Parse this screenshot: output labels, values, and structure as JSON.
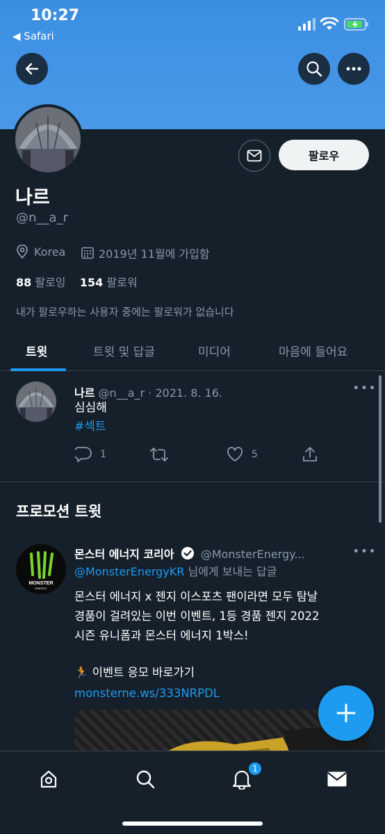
{
  "status_bar": {
    "time": "10:27",
    "back_app": "◀ Safari"
  },
  "profile": {
    "name": "나르",
    "handle": "@n__a_r",
    "follow_label": "팔로우",
    "location": "Korea",
    "joined": "2019년 11월에 가입함",
    "following_count": "88",
    "following_label": "팔로잉",
    "followers_count": "154",
    "followers_label": "팔로워",
    "followers_note": "내가 팔로우하는 사용자 중에는 팔로워가 없습니다"
  },
  "tabs": [
    {
      "label": "트윗",
      "active": true
    },
    {
      "label": "트윗 및 답글",
      "active": false
    },
    {
      "label": "미디어",
      "active": false
    },
    {
      "label": "마음에 들어요",
      "active": false
    }
  ],
  "tweet1": {
    "name": "나르",
    "handle_date": "@n__a_r · 2021. 8. 16.",
    "text": "심심해",
    "hashtag": "#섹트",
    "replies": "1",
    "likes": "5"
  },
  "promo": {
    "section_title": "프로모션 트윗",
    "name": "몬스터 에너지 코리아",
    "handle": "@MonsterEnergy...",
    "reply_to_handle": "@MonsterEnergyKR",
    "reply_to_suffix": " 님에게 보내는 답글",
    "text_line1": "몬스터 에너지 x 젠지 이스포츠 팬이라면 모두 탐날",
    "text_line2": "경품이 걸려있는 이번 이벤트, 1등 경품 젠지 2022",
    "text_line3": "시즌 유니폼과 몬스터 에너지 1박스!",
    "event_line": "🏃 이벤트 응모 바로가기",
    "link": "monsterne.ws/333NRPDL"
  },
  "bottom_nav": {
    "notification_badge": "1"
  },
  "icons": [
    "back-arrow-icon",
    "search-icon",
    "more-icon",
    "mail-icon",
    "location-icon",
    "calendar-icon",
    "reply-icon",
    "retweet-icon",
    "heart-icon",
    "share-icon",
    "verified-icon",
    "compose-icon",
    "home-icon",
    "bell-icon"
  ],
  "colors": {
    "banner": "#4a99e9",
    "background": "#15202b",
    "accent": "#1d9bf0",
    "muted": "#8899a6"
  }
}
